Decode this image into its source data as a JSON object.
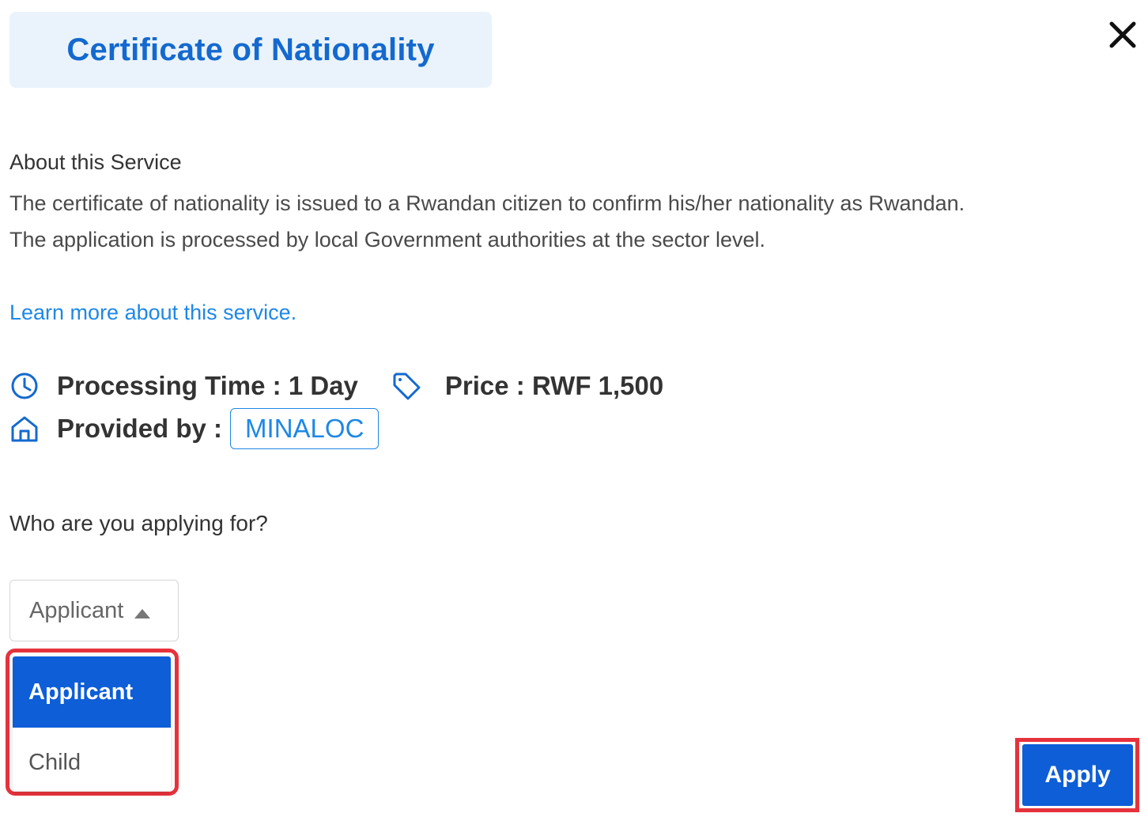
{
  "header": {
    "title": "Certificate of Nationality",
    "close_icon": "close-icon"
  },
  "about": {
    "heading": "About this Service",
    "line1": "The certificate of nationality is issued to a Rwandan citizen to confirm his/her nationality as Rwandan.",
    "line2": "The application is processed by local Government authorities at the sector level."
  },
  "learn_more": "Learn more about this service.",
  "meta": {
    "processing_time": "Processing Time : 1 Day",
    "processing_icon": "clock-icon",
    "price": "Price : RWF 1,500",
    "price_icon": "tag-icon",
    "provided_by_label": "Provided by :",
    "provided_by_icon": "home-icon",
    "provider": "MINALOC"
  },
  "form": {
    "question": "Who are you applying for?",
    "selected_value": "Applicant",
    "options": [
      "Applicant",
      "Child"
    ]
  },
  "actions": {
    "apply_label": "Apply"
  },
  "colors": {
    "accent": "#1469cf",
    "link": "#1e88e5",
    "primary_button": "#0d5ed7",
    "highlight_border": "#e6323c",
    "title_background": "#eaf3fc"
  }
}
